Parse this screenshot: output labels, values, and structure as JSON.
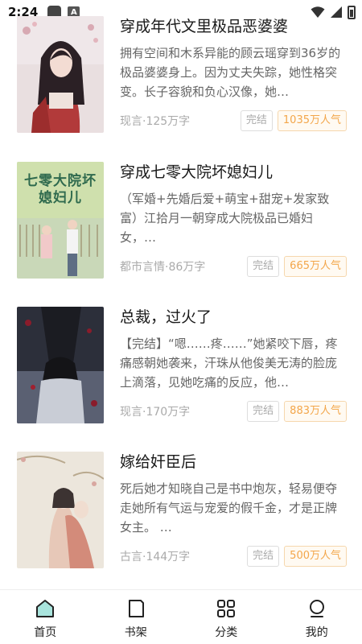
{
  "status_bar": {
    "time": "2:24",
    "notif_glyph": "A"
  },
  "books": [
    {
      "title": "穿成年代文里极品恶婆婆",
      "description": "拥有空间和木系异能的顾云瑶穿到36岁的极品婆婆身上。因为丈夫失踪，她性格突变。长子容貌和负心汉像，她…",
      "meta": "现言·125万字",
      "status": "完结",
      "popularity": "1035万人气"
    },
    {
      "title": "穿成七零大院坏媳妇儿",
      "description": "（军婚+先婚后爱+萌宝+甜宠+发家致富）江拾月一朝穿成大院极品已婚妇女，…",
      "meta": "都市言情·86万字",
      "status": "完结",
      "popularity": "665万人气",
      "cover_text": "七零大院坏媳妇儿"
    },
    {
      "title": "总裁，过火了",
      "description": "【完结】“嗯……疼……”她紧咬下唇，疼痛感朝她袭来，汗珠从他俊美无涛的脸庞上滴落，见她吃痛的反应，他…",
      "meta": "现言·170万字",
      "status": "完结",
      "popularity": "883万人气"
    },
    {
      "title": "嫁给奸臣后",
      "description": "死后她才知晓自己是书中炮灰，轻易便夺走她所有气运与宠爱的假千金，才是正牌女主。 …",
      "meta": "古言·144万字",
      "status": "完结",
      "popularity": "500万人气"
    }
  ],
  "nav": [
    {
      "label": "首页",
      "icon": "home-icon",
      "active": true
    },
    {
      "label": "书架",
      "icon": "bookshelf-icon"
    },
    {
      "label": "分类",
      "icon": "category-grid-icon"
    },
    {
      "label": "我的",
      "icon": "profile-icon"
    }
  ],
  "colors": {
    "accent": "#2aa39a",
    "popularity": "#f3a64a",
    "muted": "#aaaaaa"
  }
}
